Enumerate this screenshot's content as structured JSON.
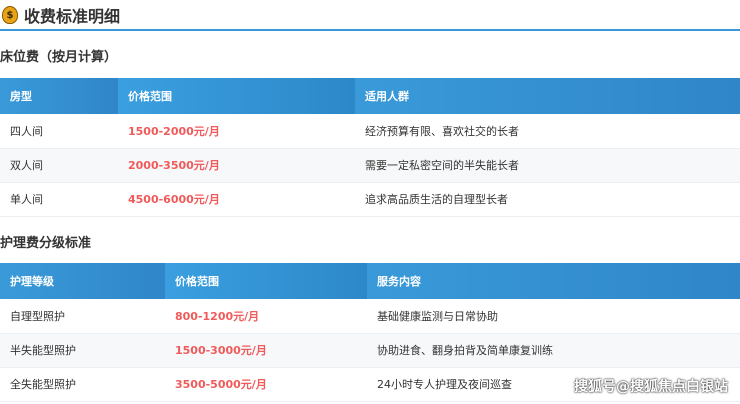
{
  "title": "收费标准明细",
  "bed": {
    "heading": "床位费（按月计算）",
    "headers": [
      "房型",
      "价格范围",
      "适用人群"
    ],
    "rows": [
      [
        "四人间",
        "1500-2000元/月",
        "经济预算有限、喜欢社交的长者"
      ],
      [
        "双人间",
        "2000-3500元/月",
        "需要一定私密空间的半失能长者"
      ],
      [
        "单人间",
        "4500-6000元/月",
        "追求高品质生活的自理型长者"
      ]
    ]
  },
  "care": {
    "heading": "护理费分级标准",
    "headers": [
      "护理等级",
      "价格范围",
      "服务内容"
    ],
    "rows": [
      [
        "自理型照护",
        "800-1200元/月",
        "基础健康监测与日常协助"
      ],
      [
        "半失能型照护",
        "1500-3000元/月",
        "协助进食、翻身拍背及简单康复训练"
      ],
      [
        "全失能型照护",
        "3500-5000元/月",
        "24小时专人护理及夜间巡查"
      ]
    ]
  },
  "watermark": "搜狐号@搜狐焦点白银站"
}
